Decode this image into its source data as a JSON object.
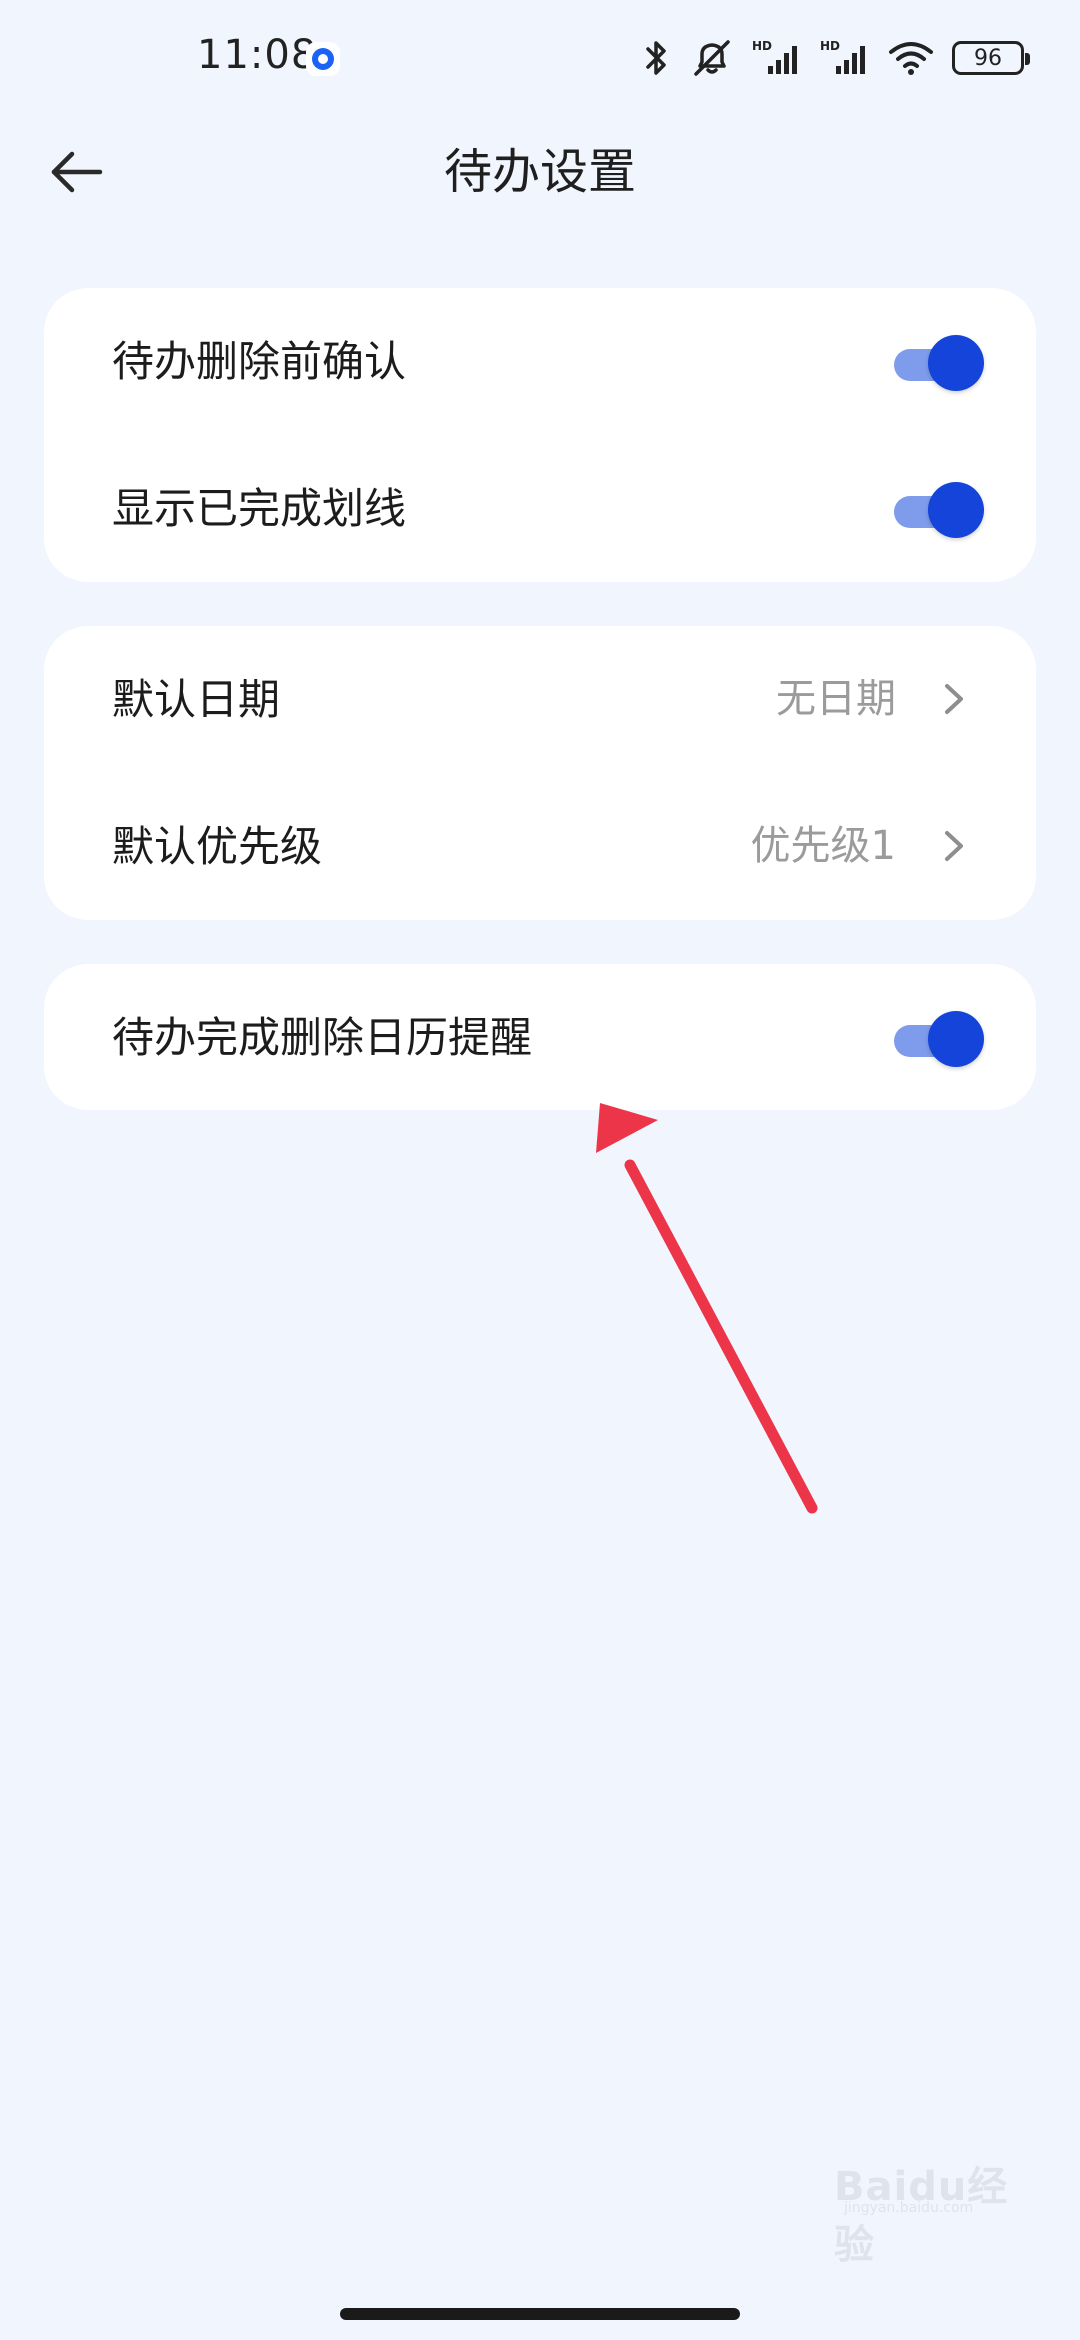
{
  "status_bar": {
    "time": "11:08",
    "battery_level": "96",
    "icons": [
      "bluetooth-icon",
      "mute-icon",
      "hd-signal-icon",
      "hd-signal-icon",
      "wifi-icon",
      "battery-icon"
    ]
  },
  "header": {
    "title": "待办设置",
    "back_icon": "back-arrow-icon"
  },
  "settings": {
    "group1": [
      {
        "label": "待办删除前确认",
        "type": "toggle",
        "on": true
      },
      {
        "label": "显示已完成划线",
        "type": "toggle",
        "on": true
      }
    ],
    "group2": [
      {
        "label": "默认日期",
        "value": "无日期",
        "type": "nav"
      },
      {
        "label": "默认优先级",
        "value": "优先级1",
        "type": "nav"
      }
    ],
    "group3": [
      {
        "label": "待办完成删除日历提醒",
        "type": "toggle",
        "on": true
      }
    ]
  },
  "colors": {
    "background": "#F1F5FE",
    "card": "#FFFFFF",
    "toggle_knob": "#1444DA",
    "toggle_track": "#7E9CEB",
    "annotation_arrow": "#EC3548"
  },
  "watermark": {
    "text": "Baidu经验",
    "sub": "jingyan.baidu.com"
  }
}
